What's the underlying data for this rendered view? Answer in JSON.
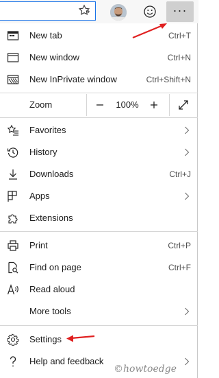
{
  "menu": {
    "new_tab": {
      "label": "New tab",
      "shortcut": "Ctrl+T"
    },
    "new_window": {
      "label": "New window",
      "shortcut": "Ctrl+N"
    },
    "new_inprivate": {
      "label": "New InPrivate window",
      "shortcut": "Ctrl+Shift+N"
    },
    "zoom": {
      "label": "Zoom",
      "minus": "—",
      "value": "100%",
      "plus": "+"
    },
    "favorites": {
      "label": "Favorites"
    },
    "history": {
      "label": "History"
    },
    "downloads": {
      "label": "Downloads",
      "shortcut": "Ctrl+J"
    },
    "apps": {
      "label": "Apps"
    },
    "extensions": {
      "label": "Extensions"
    },
    "print": {
      "label": "Print",
      "shortcut": "Ctrl+P"
    },
    "find": {
      "label": "Find on page",
      "shortcut": "Ctrl+F"
    },
    "read_aloud": {
      "label": "Read aloud"
    },
    "more_tools": {
      "label": "More tools"
    },
    "settings": {
      "label": "Settings"
    },
    "help": {
      "label": "Help and feedback"
    }
  },
  "toolbar": {
    "more_label": "···"
  },
  "watermark": "©howtoedge",
  "colors": {
    "accent_border": "#1a73e8",
    "annotation_arrow": "#e02020",
    "more_button_bg": "#cfcfcf"
  }
}
